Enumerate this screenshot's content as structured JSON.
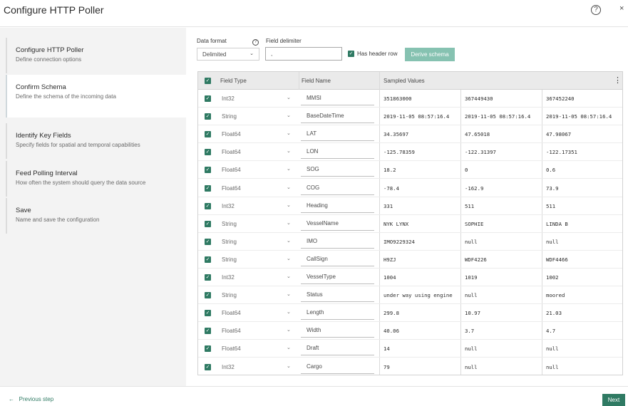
{
  "window": {
    "title": "Configure HTTP Poller",
    "help_icon": "?",
    "close_icon": "×"
  },
  "steps": [
    {
      "title": "Configure HTTP Poller",
      "desc": "Define connection options"
    },
    {
      "title": "Confirm Schema",
      "desc": "Define the schema of the incoming data"
    },
    {
      "title": "Identify Key Fields",
      "desc": "Specify fields for spatial and temporal capabilities"
    },
    {
      "title": "Feed Polling Interval",
      "desc": "How often the system should query the data source"
    },
    {
      "title": "Save",
      "desc": "Name and save the configuration"
    }
  ],
  "form": {
    "data_format_label": "Data format",
    "data_format_value": "Delimited",
    "field_delimiter_label": "Field delimiter",
    "field_delimiter_value": ",",
    "has_header_row_label": "Has header row",
    "has_header_row_checked": true,
    "derive_button": "Derive schema"
  },
  "grid": {
    "headers": {
      "field_type": "Field Type",
      "field_name": "Field Name",
      "sampled_values": "Sampled Values"
    },
    "rows": [
      {
        "type": "Int32",
        "name": "MMSI",
        "s1": "351863000",
        "s2": "367449430",
        "s3": "367452240"
      },
      {
        "type": "String",
        "name": "BaseDateTime",
        "s1": "2019-11-05 08:57:16.4",
        "s2": "2019-11-05 08:57:16.4",
        "s3": "2019-11-05 08:57:16.4"
      },
      {
        "type": "Float64",
        "name": "LAT",
        "s1": "34.35697",
        "s2": "47.65018",
        "s3": "47.98067"
      },
      {
        "type": "Float64",
        "name": "LON",
        "s1": "-125.78359",
        "s2": "-122.31397",
        "s3": "-122.17351"
      },
      {
        "type": "Float64",
        "name": "SOG",
        "s1": "18.2",
        "s2": "0",
        "s3": "0.6"
      },
      {
        "type": "Float64",
        "name": "COG",
        "s1": "-78.4",
        "s2": "-162.9",
        "s3": "73.9"
      },
      {
        "type": "Int32",
        "name": "Heading",
        "s1": "331",
        "s2": "511",
        "s3": "511"
      },
      {
        "type": "String",
        "name": "VesselName",
        "s1": "NYK LYNX",
        "s2": "SOPHIE",
        "s3": "LINDA B"
      },
      {
        "type": "String",
        "name": "IMO",
        "s1": "IMO9229324",
        "s2": "null",
        "s3": "null"
      },
      {
        "type": "String",
        "name": "CallSign",
        "s1": "H9ZJ",
        "s2": "WDF4226",
        "s3": "WDF4466"
      },
      {
        "type": "Int32",
        "name": "VesselType",
        "s1": "1004",
        "s2": "1019",
        "s3": "1002"
      },
      {
        "type": "String",
        "name": "Status",
        "s1": "under way using engine",
        "s2": "null",
        "s3": "moored"
      },
      {
        "type": "Float64",
        "name": "Length",
        "s1": "299.8",
        "s2": "10.97",
        "s3": "21.03"
      },
      {
        "type": "Float64",
        "name": "Width",
        "s1": "40.06",
        "s2": "3.7",
        "s3": "4.7"
      },
      {
        "type": "Float64",
        "name": "Draft",
        "s1": "14",
        "s2": "null",
        "s3": "null"
      },
      {
        "type": "Int32",
        "name": "Cargo",
        "s1": "79",
        "s2": "null",
        "s3": "null"
      }
    ]
  },
  "footer": {
    "previous": "Previous step",
    "previous_arrow": "←",
    "next": "Next"
  },
  "colors": {
    "accent": "#2f7a63",
    "derive_button": "#86c2b1",
    "sidebar_bg": "#f3f3f3"
  }
}
